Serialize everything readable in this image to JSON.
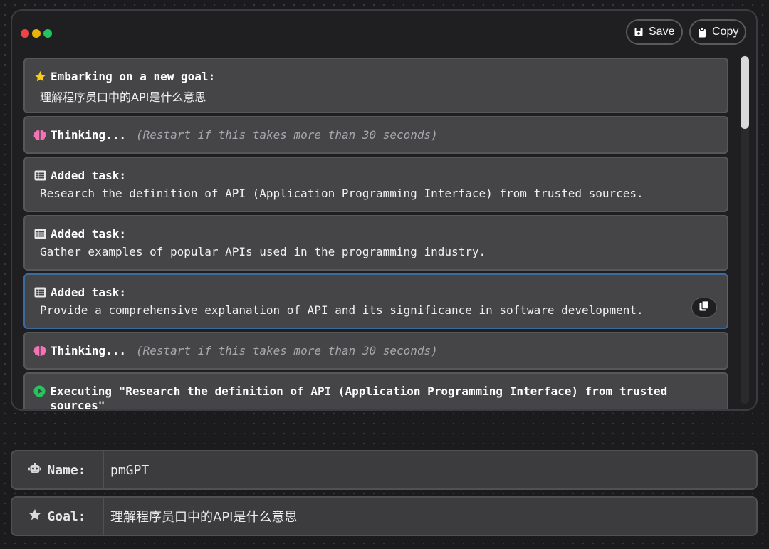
{
  "toolbar": {
    "save_label": "Save",
    "copy_label": "Copy"
  },
  "messages": [
    {
      "icon": "star-icon",
      "title": "Embarking on a new goal:",
      "body": "理解程序员口中的API是什么意思"
    },
    {
      "icon": "brain-icon",
      "title": "Thinking...",
      "note": "(Restart if this takes more than 30 seconds)"
    },
    {
      "icon": "task-list-icon",
      "title": "Added task:",
      "body": "Research the definition of API (Application Programming Interface) from trusted sources."
    },
    {
      "icon": "task-list-icon",
      "title": "Added task:",
      "body": "Gather examples of popular APIs used in the programming industry."
    },
    {
      "icon": "task-list-icon",
      "title": "Added task:",
      "body": "Provide a comprehensive explanation of API and its significance in software development."
    },
    {
      "icon": "brain-icon",
      "title": "Thinking...",
      "note": "(Restart if this takes more than 30 seconds)"
    },
    {
      "icon": "play-circle-icon",
      "title": "Executing \"Research the definition of API (Application Programming Interface) from trusted sources\""
    }
  ],
  "agent": {
    "name_label": "Name:",
    "name_value": "pmGPT",
    "goal_label": "Goal:",
    "goal_value": "理解程序员口中的API是什么意思"
  },
  "colors": {
    "accent_blue": "#3b6b9c",
    "star": "#facc15",
    "brain": "#f472b6",
    "play": "#22c55e"
  }
}
